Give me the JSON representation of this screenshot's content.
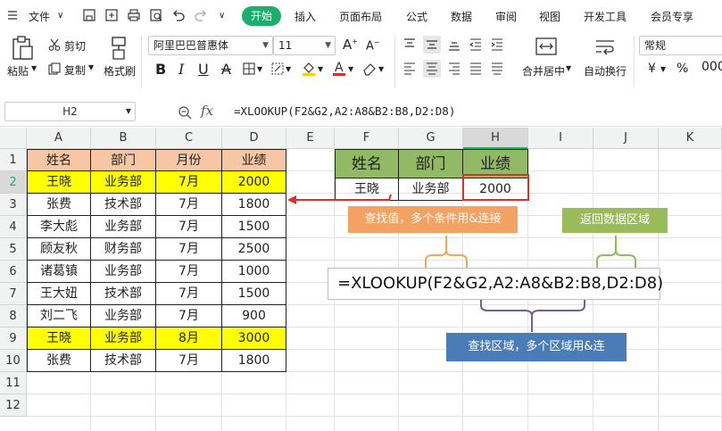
{
  "menu": {
    "file": "文件",
    "tabs": [
      "开始",
      "插入",
      "页面布局",
      "公式",
      "数据",
      "审阅",
      "视图",
      "开发工具",
      "会员专享"
    ],
    "active_tab": "开始"
  },
  "ribbon": {
    "paste": "粘贴",
    "cut": "剪切",
    "copy": "复制",
    "format_painter": "格式刷",
    "font_name": "阿里巴巴普惠体",
    "font_size": "11",
    "merge_center": "合并居中",
    "wrap_text": "自动换行",
    "number_format": "常规",
    "currency_symbol": "¥",
    "percent_symbol": "%"
  },
  "formula_bar": {
    "name_box": "H2",
    "fx": "fx",
    "formula": "=XLOOKUP(F2&G2,A2:A8&B2:B8,D2:D8)"
  },
  "columns": [
    "A",
    "B",
    "C",
    "D",
    "E",
    "F",
    "G",
    "H",
    "I",
    "J",
    "K"
  ],
  "rows": [
    "1",
    "2",
    "3",
    "4",
    "5",
    "6",
    "7",
    "8",
    "9",
    "10",
    "11",
    "12"
  ],
  "table": {
    "headers": [
      "姓名",
      "部门",
      "月份",
      "业绩"
    ],
    "rows": [
      [
        "王晓",
        "业务部",
        "7月",
        "2000"
      ],
      [
        "张费",
        "技术部",
        "7月",
        "1800"
      ],
      [
        "李大彪",
        "业务部",
        "7月",
        "1500"
      ],
      [
        "顾友秋",
        "财务部",
        "7月",
        "2500"
      ],
      [
        "诸葛镇",
        "业务部",
        "7月",
        "1000"
      ],
      [
        "王大妞",
        "技术部",
        "7月",
        "1500"
      ],
      [
        "刘二飞",
        "业务部",
        "7月",
        "900"
      ],
      [
        "王晓",
        "业务部",
        "8月",
        "3000"
      ],
      [
        "张费",
        "技术部",
        "7月",
        "1800"
      ]
    ]
  },
  "lookup": {
    "headers": [
      "姓名",
      "部门",
      "业绩"
    ],
    "values": [
      "王晓",
      "业务部",
      "2000"
    ]
  },
  "annotations": {
    "lookup_value": "查找值，多个条件用&连接",
    "return_range": "返回数据区域",
    "lookup_range": "查找区域，多个区域用&连",
    "big_formula": "=XLOOKUP(F2&G2,A2:A8&B2:B8,D2:D8)"
  },
  "colors": {
    "accent": "#1aae6f",
    "header_orange": "#f7c7a5",
    "header_green": "#92b964",
    "highlight_yellow": "#ffff00",
    "callout_orange": "#f4a164",
    "callout_green": "#9abb5a",
    "callout_blue": "#4a7cb8",
    "arrow_red": "#d9302c",
    "brace_orange": "#f2a65a",
    "brace_green": "#8cbf5a",
    "brace_purple": "#7a5a9e"
  }
}
